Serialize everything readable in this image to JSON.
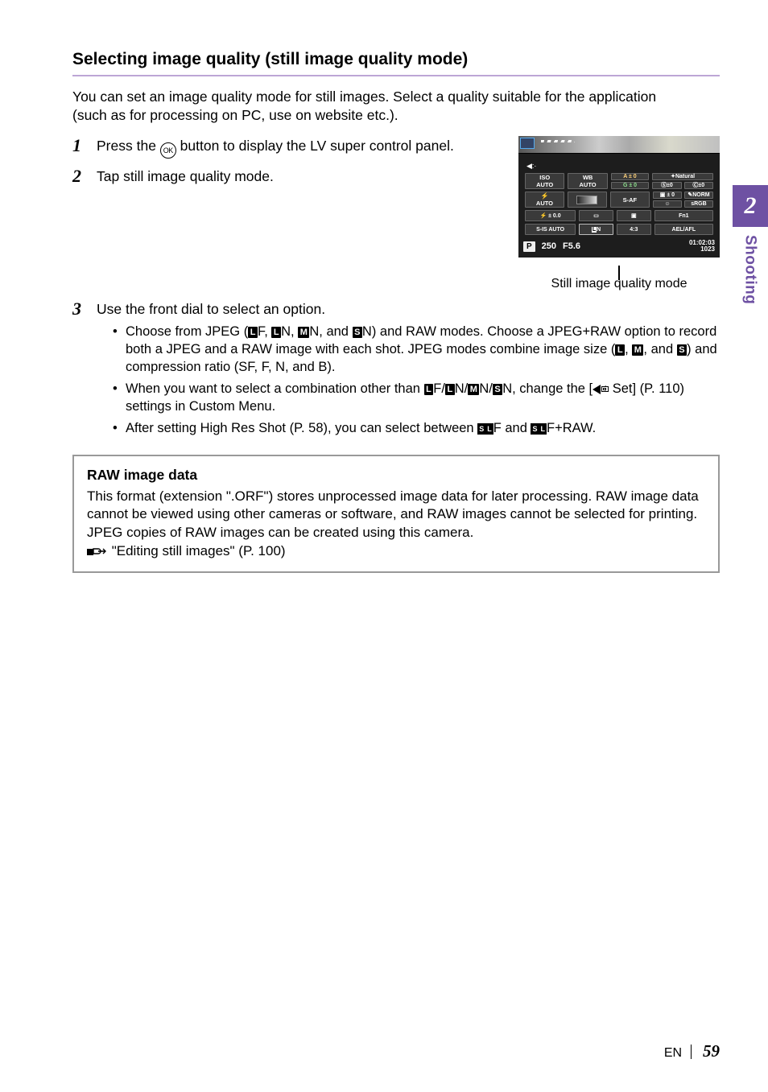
{
  "side": {
    "chapter_num": "2",
    "chapter_label": "Shooting"
  },
  "footer": {
    "lang": "EN",
    "page": "59"
  },
  "heading": "Selecting image quality (still image quality mode)",
  "intro": "You can set an image quality mode for still images. Select a quality suitable for the application (such as for processing on PC, use on website etc.).",
  "steps": {
    "s1": {
      "num": "1",
      "a": "Press the ",
      "b": " button to display the LV super control panel."
    },
    "s2": {
      "num": "2",
      "text": "Tap still image quality mode."
    },
    "s3": {
      "num": "3",
      "text": "Use the front dial to select an option."
    }
  },
  "ok_label": "OK",
  "glyphs": {
    "L": "L",
    "M": "M",
    "S": "S",
    "SL_a": "S",
    "SL_b": "L"
  },
  "bullets": {
    "b1": {
      "p0": "Choose from JPEG (",
      "p1": "F, ",
      "p2": "N, ",
      "p3": "N, and ",
      "p4": "N) and RAW modes. Choose a JPEG+RAW option to record both a JPEG and a RAW image with each shot. JPEG modes combine image size (",
      "p5": ", ",
      "p6": ", and ",
      "p7": ") and compression ratio (SF, F, N, and B)."
    },
    "b2": {
      "p0": "When you want to select a combination other than ",
      "p1": "F/",
      "p2": "N/",
      "p3": "N/",
      "p4": "N, change the [",
      "p5": " Set] (P. 110) settings in Custom Menu."
    },
    "b3": {
      "p0": "After setting High Res Shot (P. 58), you can select between ",
      "p1": "F and ",
      "p2": "F+RAW."
    }
  },
  "infobox": {
    "title": "RAW image data",
    "body": "This format (extension \".ORF\") stores unprocessed image data for later processing. RAW image data cannot be viewed using other cameras or software, and RAW images cannot be selected for printing. JPEG copies of RAW images can be created using this camera.",
    "ref": " \"Editing still images\" (P. 100)"
  },
  "panel": {
    "caption": "Still image quality mode",
    "lcd": {
      "iso": "ISO\nAUTO",
      "wb": "WB\nAUTO",
      "a0": "A ± 0",
      "g0": "G ± 0",
      "natural": "Natural",
      "s0": "Ⓢ±0",
      "c0": "Ⓒ±0",
      "flash_auto": "AUTO",
      "saf": "S-AF",
      "rgb0a": "▣ ± 0",
      "norm": "NORM",
      "face": "☺",
      "srgb": "sRGB",
      "pm0": "⚡ ± 0.0",
      "rect": "▭",
      "af": "▣",
      "fn1": "Fn1",
      "sis": "S-IS AUTO",
      "ln": "LN",
      "asp": "4:3",
      "ael": "AEL/AFL",
      "p": "P",
      "sp": "250",
      "ap": "F5.6",
      "time": "01:02:03",
      "shots": "1023"
    }
  }
}
